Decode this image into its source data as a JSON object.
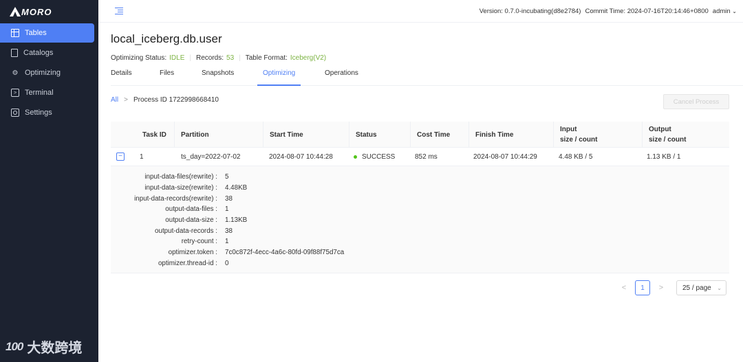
{
  "brand": {
    "name": "MORO",
    "watermark_logo": "100",
    "watermark_text": "大数跨境"
  },
  "sidebar": {
    "items": [
      {
        "label": "Tables",
        "icon": "table-icon",
        "active": true
      },
      {
        "label": "Catalogs",
        "icon": "book-icon"
      },
      {
        "label": "Optimizing",
        "icon": "gear-icon"
      },
      {
        "label": "Terminal",
        "icon": "terminal-icon"
      },
      {
        "label": "Settings",
        "icon": "settings-icon"
      }
    ]
  },
  "header": {
    "version": "Version: 0.7.0-incubating(d8e2784)",
    "commit": "Commit Time: 2024-07-16T20:14:46+0800",
    "user": "admin"
  },
  "page": {
    "title": "local_iceberg.db.user",
    "status_label": "Optimizing Status:",
    "status_value": "IDLE",
    "records_label": "Records:",
    "records_value": "53",
    "format_label": "Table Format:",
    "format_value": "Iceberg(V2)"
  },
  "tabs": [
    "Details",
    "Files",
    "Snapshots",
    "Optimizing",
    "Operations"
  ],
  "active_tab": "Optimizing",
  "breadcrumb": {
    "root": "All",
    "separator": ">",
    "current": "Process ID 1722998668410"
  },
  "cancel_button": "Cancel Process",
  "table": {
    "columns": [
      "Task ID",
      "Partition",
      "Start Time",
      "Status",
      "Cost Time",
      "Finish Time"
    ],
    "input_header": [
      "Input",
      "size / count"
    ],
    "output_header": [
      "Output",
      "size / count"
    ],
    "row": {
      "task_id": "1",
      "partition": "ts_day=2022-07-02",
      "start_time": "2024-08-07 10:44:28",
      "status": "SUCCESS",
      "cost_time": "852 ms",
      "finish_time": "2024-08-07 10:44:29",
      "input": "4.48 KB / 5",
      "output": "1.13 KB / 1"
    },
    "details": [
      {
        "key": "input-data-files(rewrite) :",
        "value": "5"
      },
      {
        "key": "input-data-size(rewrite) :",
        "value": "4.48KB"
      },
      {
        "key": "input-data-records(rewrite) :",
        "value": "38"
      },
      {
        "key": "output-data-files :",
        "value": "1"
      },
      {
        "key": "output-data-size :",
        "value": "1.13KB"
      },
      {
        "key": "output-data-records :",
        "value": "38"
      },
      {
        "key": "retry-count :",
        "value": "1"
      },
      {
        "key": "optimizer.token :",
        "value": "7c0c872f-4ecc-4a6c-80fd-09f88f75d7ca"
      },
      {
        "key": "optimizer.thread-id :",
        "value": "0"
      }
    ]
  },
  "pagination": {
    "prev": "<",
    "page": "1",
    "next": ">",
    "page_size": "25 / page"
  },
  "colors": {
    "accent": "#4f7ff4",
    "sidebar_bg": "#1c2230",
    "success": "#52c41a",
    "status_green": "#7cb342"
  }
}
